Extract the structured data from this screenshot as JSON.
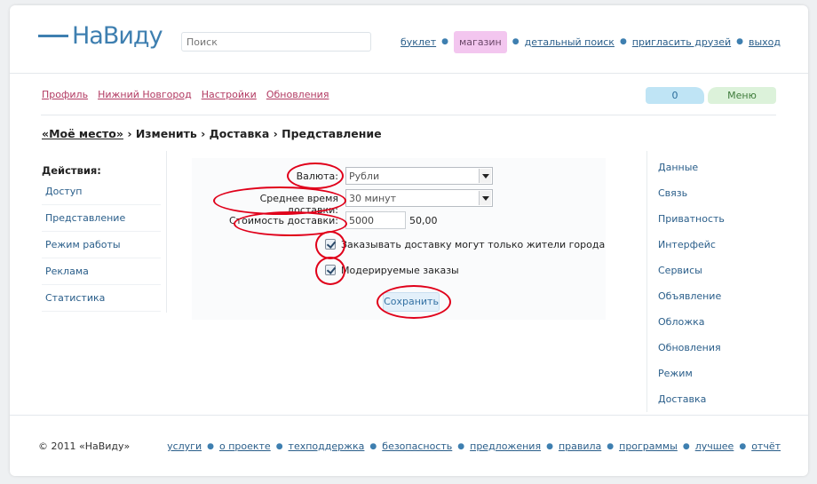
{
  "logo": {
    "text": "НаВиду"
  },
  "search": {
    "placeholder": "Поиск"
  },
  "topnav": [
    {
      "label": "буклет",
      "highlight": false
    },
    {
      "label": "магазин",
      "highlight": true
    },
    {
      "label": "детальный поиск",
      "highlight": false
    },
    {
      "label": "пригласить друзей",
      "highlight": false
    },
    {
      "label": "выход",
      "highlight": false
    }
  ],
  "subnav": [
    "Профиль",
    "Нижний Новгород",
    "Настройки",
    "Обновления"
  ],
  "counter": {
    "value": "0",
    "menu_label": "Меню"
  },
  "breadcrumb": {
    "home": "«Моё место»",
    "rest": "› Изменить › Доставка › Представление"
  },
  "actions": {
    "title": "Действия:",
    "items": [
      "Доступ",
      "Представление",
      "Режим работы",
      "Реклама",
      "Статистика"
    ]
  },
  "form": {
    "currency_label": "Валюта:",
    "currency_value": "Рубли",
    "delivery_time_label": "Среднее время доставки:",
    "delivery_time_value": "30 минут",
    "delivery_cost_label": "Стоимость доставки:",
    "delivery_cost_value": "5000",
    "delivery_cost_display": "50,00",
    "residents_only_label": "Заказывать доставку могут только жители города",
    "residents_only_checked": true,
    "moderated_label": "Модерируемые заказы",
    "moderated_checked": true,
    "save_label": "Сохранить"
  },
  "rightmenu": [
    "Данные",
    "Связь",
    "Приватность",
    "Интерфейс",
    "Сервисы",
    "Объявление",
    "Обложка",
    "Обновления",
    "Режим",
    "Доставка"
  ],
  "footer": {
    "copyright": "© 2011 «НаВиду»",
    "links": [
      "услуги",
      "о проекте",
      "техподдержка",
      "безопасность",
      "предложения",
      "правила",
      "программы",
      "лучшее",
      "отчёт"
    ]
  },
  "colors": {
    "brand": "#3e7fb0",
    "accent_pink": "#b23a62",
    "annotation": "#e0001a"
  }
}
